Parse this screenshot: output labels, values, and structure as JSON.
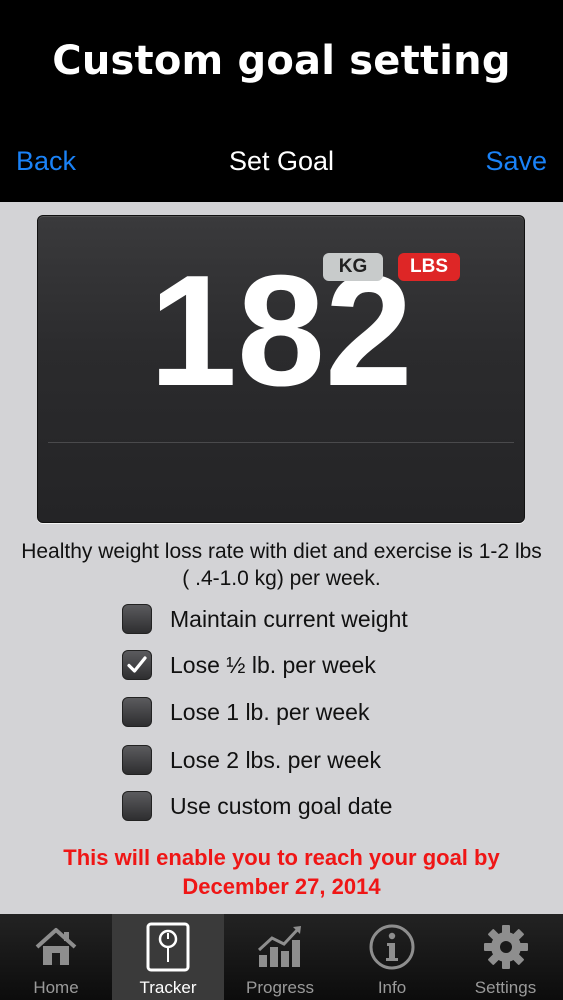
{
  "banner": {
    "title": "Custom goal setting"
  },
  "navbar": {
    "back_label": "Back",
    "title": "Set Goal",
    "save_label": "Save"
  },
  "display": {
    "value": "182",
    "units": [
      "KG",
      "LBS"
    ],
    "selected_unit": "LBS"
  },
  "info_text": "Healthy weight loss rate with diet and exercise is 1-2 lbs ( .4-1.0 kg) per week.",
  "options": [
    {
      "label": "Maintain current weight",
      "checked": false
    },
    {
      "label": "Lose ½ lb. per week",
      "checked": true
    },
    {
      "label": "Lose 1 lb. per week",
      "checked": false
    },
    {
      "label": "Lose 2 lbs. per week",
      "checked": false
    },
    {
      "label": "Use custom goal date",
      "checked": false
    }
  ],
  "goal_message": {
    "line1": "This will enable you to reach your goal by",
    "line2": "December 27, 2014"
  },
  "tabs": [
    {
      "label": "Home",
      "icon": "house-icon"
    },
    {
      "label": "Tracker",
      "icon": "scale-icon",
      "active": true
    },
    {
      "label": "Progress",
      "icon": "chart-icon"
    },
    {
      "label": "Info",
      "icon": "info-icon"
    },
    {
      "label": "Settings",
      "icon": "gear-icon"
    }
  ],
  "colors": {
    "accent": "#1a82f7",
    "lbs_selected": "#de2626",
    "goal_text": "#ef1616",
    "background": "#d3d3d6"
  }
}
